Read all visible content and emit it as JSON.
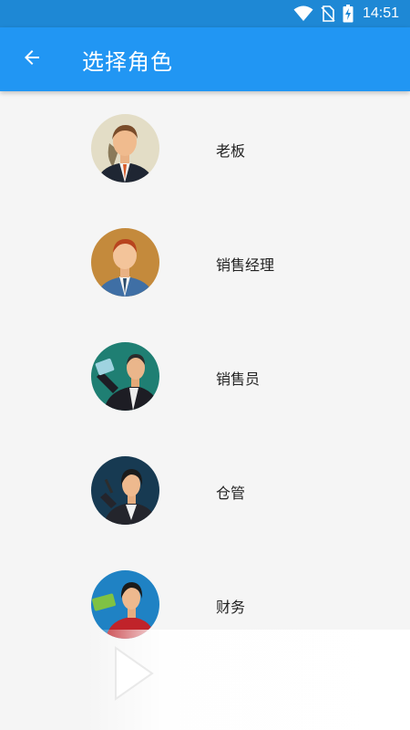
{
  "status_bar": {
    "time": "14:51",
    "icons": [
      "wifi-icon",
      "no-sim-icon",
      "battery-charging-icon"
    ]
  },
  "app_bar": {
    "title": "选择角色",
    "back_icon": "arrow-back-icon"
  },
  "roles": [
    {
      "label": "老板",
      "avatar": "boss-avatar"
    },
    {
      "label": "销售经理",
      "avatar": "sales-manager-avatar"
    },
    {
      "label": "销售员",
      "avatar": "salesperson-avatar"
    },
    {
      "label": "仓管",
      "avatar": "warehouse-keeper-avatar"
    },
    {
      "label": "财务",
      "avatar": "finance-avatar"
    }
  ],
  "overlay": {
    "icon": "play-icon"
  },
  "colors": {
    "primary": "#2196f3",
    "status_bar": "#1e88d5",
    "background": "#f5f5f5"
  }
}
